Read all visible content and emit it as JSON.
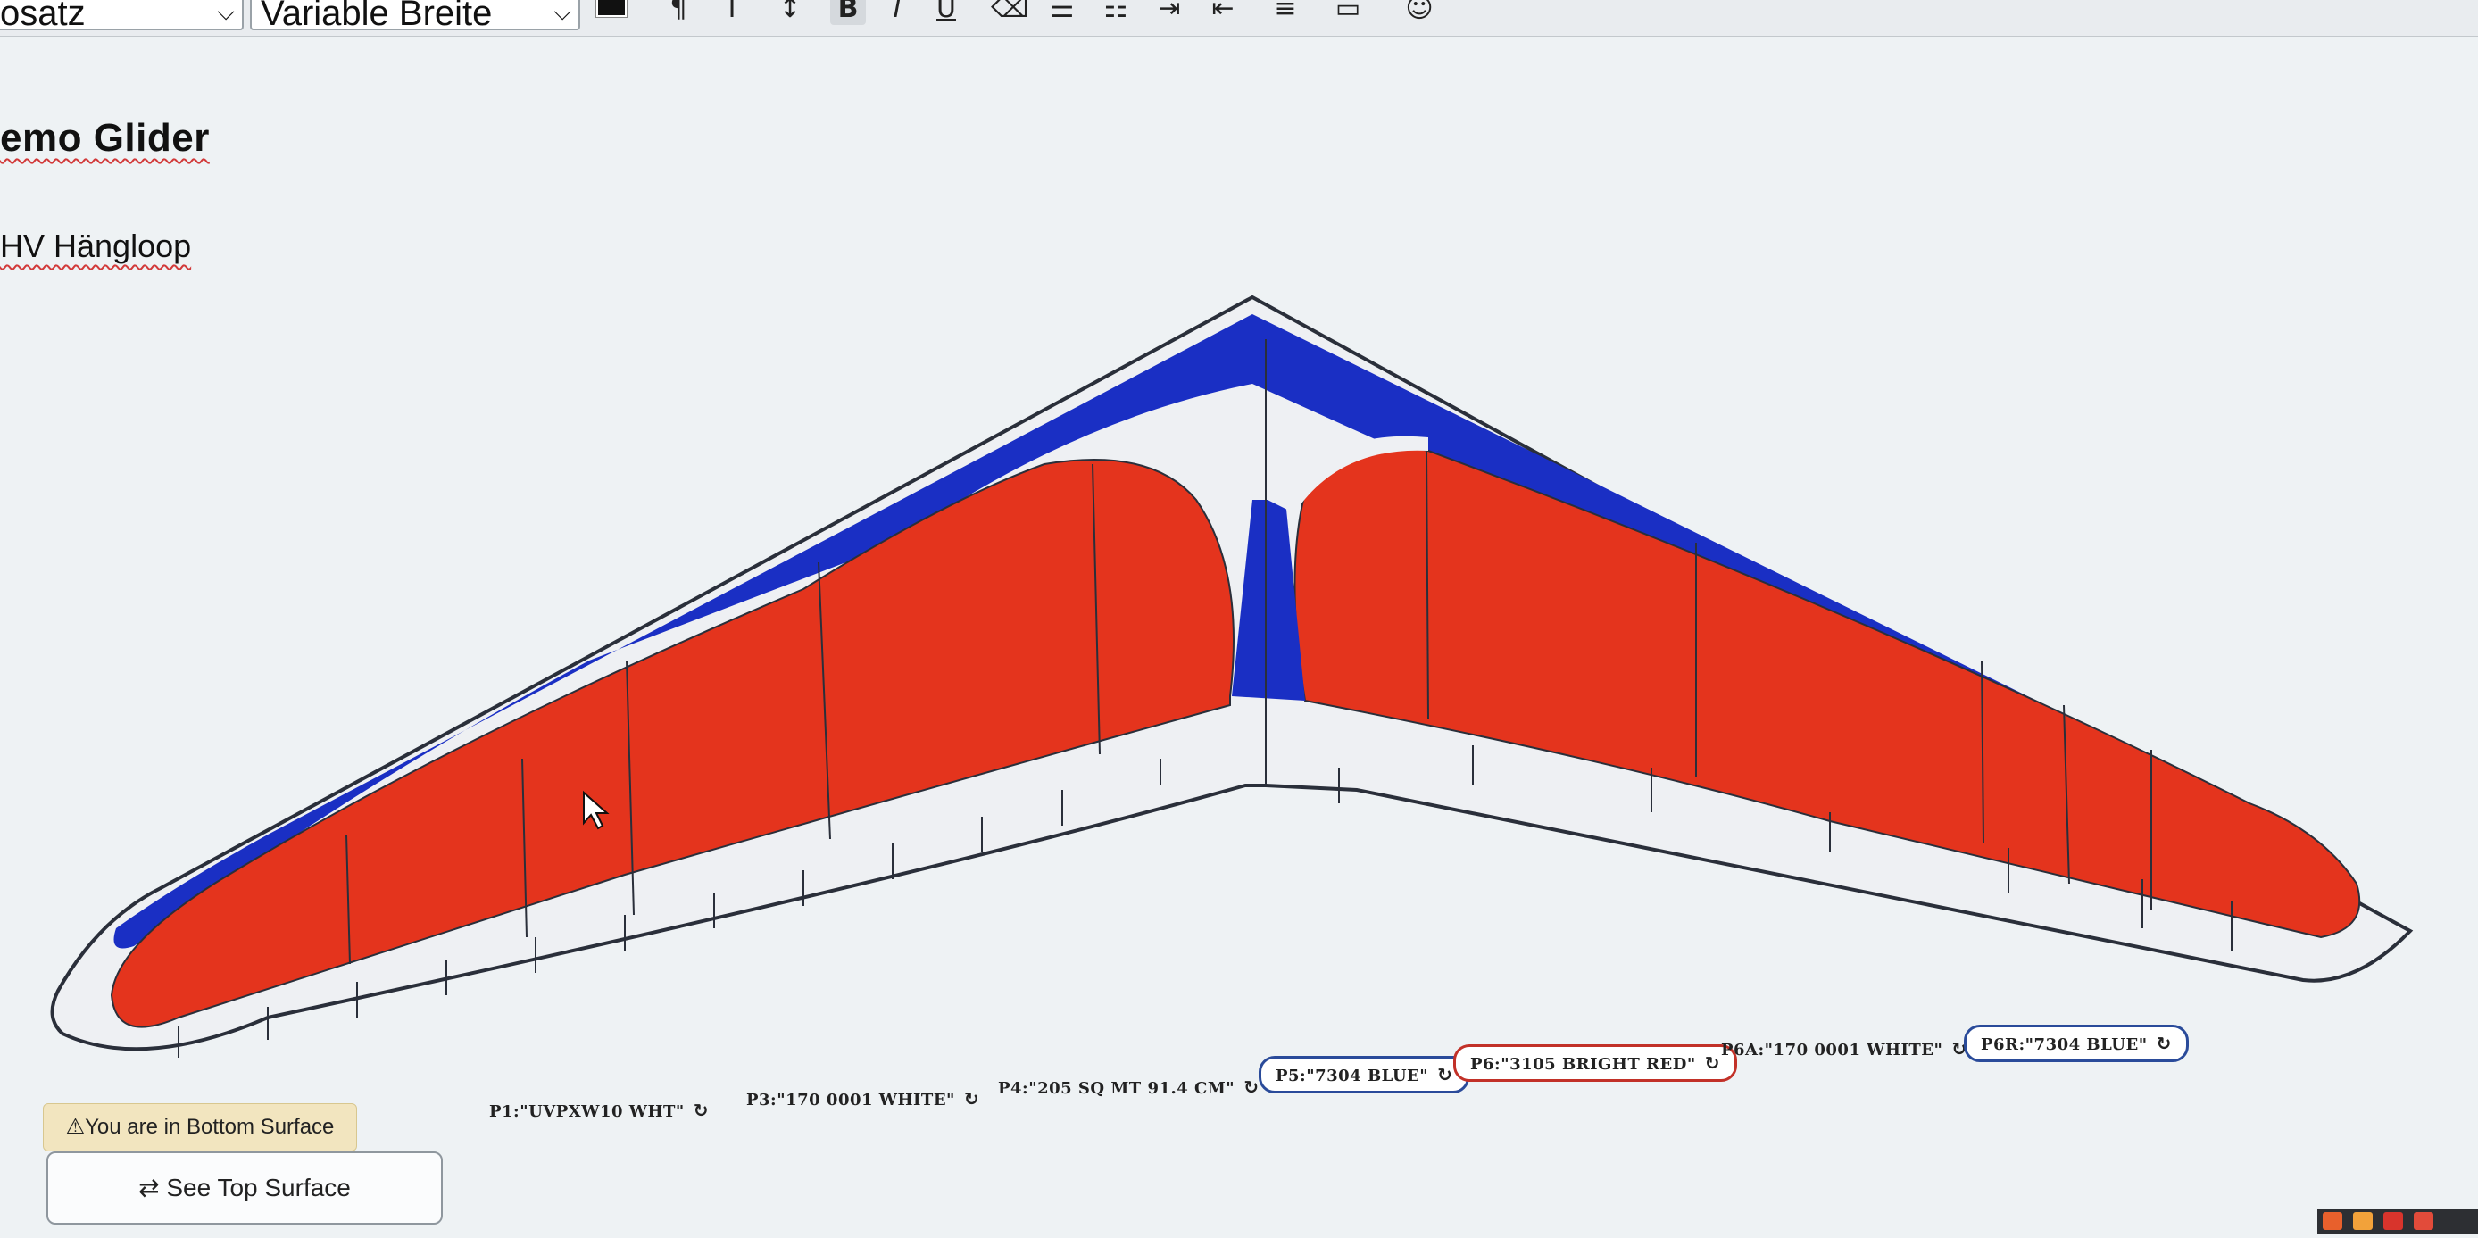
{
  "toolbar": {
    "paragraph_style": "osatz",
    "width_mode": "Variable Breite",
    "icons": [
      "color-swatch-icon",
      "paragraph-icon",
      "font-size-icon",
      "text-height-icon",
      "bold-icon",
      "italic-icon",
      "underline-icon",
      "clear-format-icon",
      "list-icon",
      "numbered-list-icon",
      "indent-icon",
      "outdent-icon",
      "align-icon",
      "image-icon",
      "emoji-icon"
    ]
  },
  "document": {
    "title": "emo Glider",
    "subtitle": "HV Hängloop"
  },
  "glider": {
    "colors": {
      "blue": "#1a2fc4",
      "red": "#e4341d",
      "white": "#eef0f3",
      "outline": "#2a2f3a"
    }
  },
  "panels": [
    {
      "label": "P1:\"UVPXW10 WHT\"",
      "outlined": false,
      "color": null
    },
    {
      "label": "P3:\"170 0001 WHITE\"",
      "outlined": false,
      "color": null
    },
    {
      "label": "P4:\"205 SQ MT 91.4 CM\"",
      "outlined": false,
      "color": null
    },
    {
      "label": "P5:\"7304 BLUE\"",
      "outlined": true,
      "color": "#2a4b9a"
    },
    {
      "label": "P6:\"3105 BRIGHT RED\"",
      "outlined": true,
      "color": "#c23128"
    },
    {
      "label": "P6A:\"170 0001 WHITE\"",
      "outlined": false,
      "color": null
    },
    {
      "label": "P6R:\"7304 BLUE\"",
      "outlined": true,
      "color": "#2a4b9a"
    }
  ],
  "status": {
    "surface_text": "You are in Bottom Surface",
    "switch_button": "See Top Surface"
  },
  "tray_colors": [
    "#e8602c",
    "#f2a23a",
    "#d8342c",
    "#e24b3a"
  ]
}
